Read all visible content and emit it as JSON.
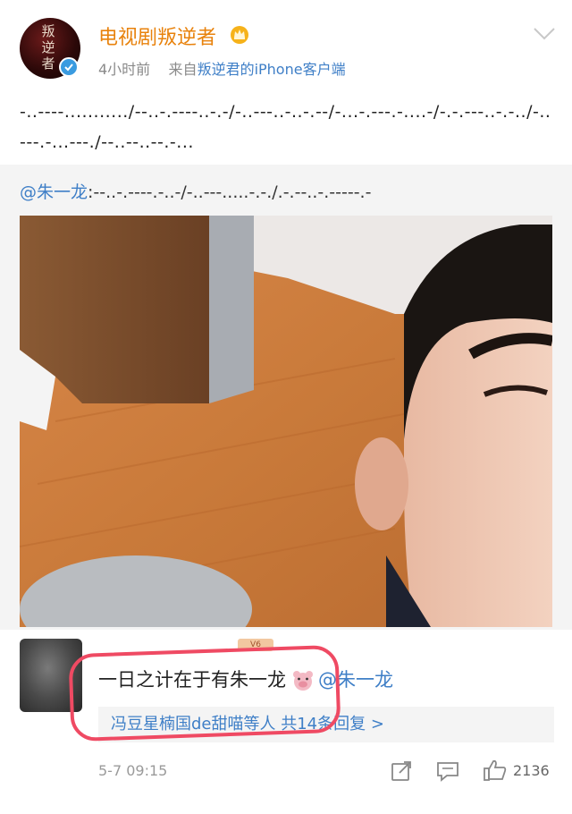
{
  "post": {
    "author": "电视剧叛逆者",
    "avatar_text": "叛逆者",
    "time": "4小时前",
    "source_prefix": "来自",
    "source": "叛逆君的iPhone客户端",
    "text": "-..----.........../--..-.----..-.-/-..---..-..-.--/-...-.---.-....-/-.-.---..-.-../-..---.-...---./--..--..--.-..."
  },
  "repost": {
    "mention": "@朱一龙",
    "text": ":--..-.----.-..-/-..---.....-.-./.-.--..-.-----.-"
  },
  "comment": {
    "badge": "V6",
    "text": "一日之计在于有朱一龙",
    "mention": "@朱一龙",
    "replies": "冯豆星楠国de甜喵等人 共14条回复 >",
    "time": "5-7 09:15",
    "likes": "2136"
  },
  "colors": {
    "author": "#e8820c",
    "link": "#3f7fc7",
    "highlight": "#ef4a63"
  },
  "icons": {
    "crown": "crown-icon",
    "verified": "verified-icon",
    "chevron": "chevron-down-icon",
    "share": "share-icon",
    "comment": "comment-icon",
    "like": "thumbs-up-icon",
    "pig": "pig-emoji-icon"
  }
}
